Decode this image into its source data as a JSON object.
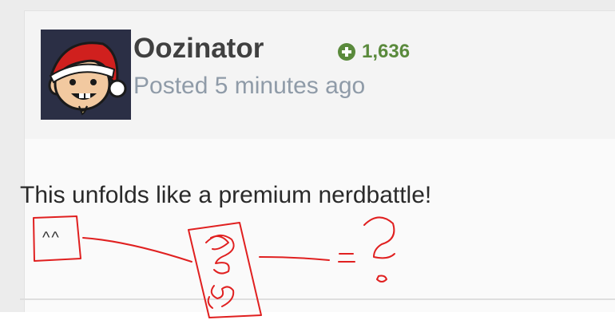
{
  "post": {
    "author": "Oozinator",
    "reputation": "1,636",
    "posted": "Posted 5 minutes ago",
    "body": "This unfolds like a premium nerdbattle!"
  },
  "annotation": {
    "caret_text": "^^"
  },
  "colors": {
    "reputation_green": "#5a8a3c",
    "scribble_red": "#e02020",
    "avatar_bg": "#2b2f45"
  },
  "icons": {
    "reputation": "plus-circle-icon"
  }
}
